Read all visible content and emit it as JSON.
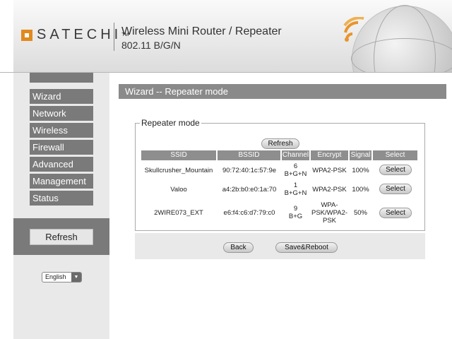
{
  "header": {
    "brand": "SATECHI",
    "brand_mark": "TM",
    "product_title": "Wireless Mini Router / Repeater",
    "product_subtitle": "802.11 B/G/N"
  },
  "sidebar": {
    "items": [
      {
        "label": "Wizard"
      },
      {
        "label": "Network"
      },
      {
        "label": "Wireless"
      },
      {
        "label": "Firewall"
      },
      {
        "label": "Advanced"
      },
      {
        "label": "Management"
      },
      {
        "label": "Status"
      }
    ],
    "refresh_label": "Refresh",
    "language": "English"
  },
  "main": {
    "page_title": "Wizard -- Repeater mode",
    "legend": "Repeater mode",
    "refresh_label": "Refresh",
    "columns": [
      "SSID",
      "BSSID",
      "Channel",
      "Encrypt",
      "Signal",
      "Select"
    ],
    "rows": [
      {
        "ssid": "Skullcrusher_Mountain",
        "bssid": "90:72:40:1c:57:9e",
        "channel_num": "6",
        "channel_mode": "B+G+N",
        "encrypt": [
          "WPA2-PSK"
        ],
        "signal": "100%",
        "select": "Select"
      },
      {
        "ssid": "Valoo",
        "bssid": "a4:2b:b0:e0:1a:70",
        "channel_num": "1",
        "channel_mode": "B+G+N",
        "encrypt": [
          "WPA2-PSK"
        ],
        "signal": "100%",
        "select": "Select"
      },
      {
        "ssid": "2WIRE073_EXT",
        "bssid": "e6:f4:c6:d7:79:c0",
        "channel_num": "9",
        "channel_mode": "B+G",
        "encrypt": [
          "WPA-",
          "PSK/WPA2-",
          "PSK"
        ],
        "signal": "50%",
        "select": "Select"
      }
    ],
    "back_label": "Back",
    "save_label": "Save&Reboot"
  }
}
